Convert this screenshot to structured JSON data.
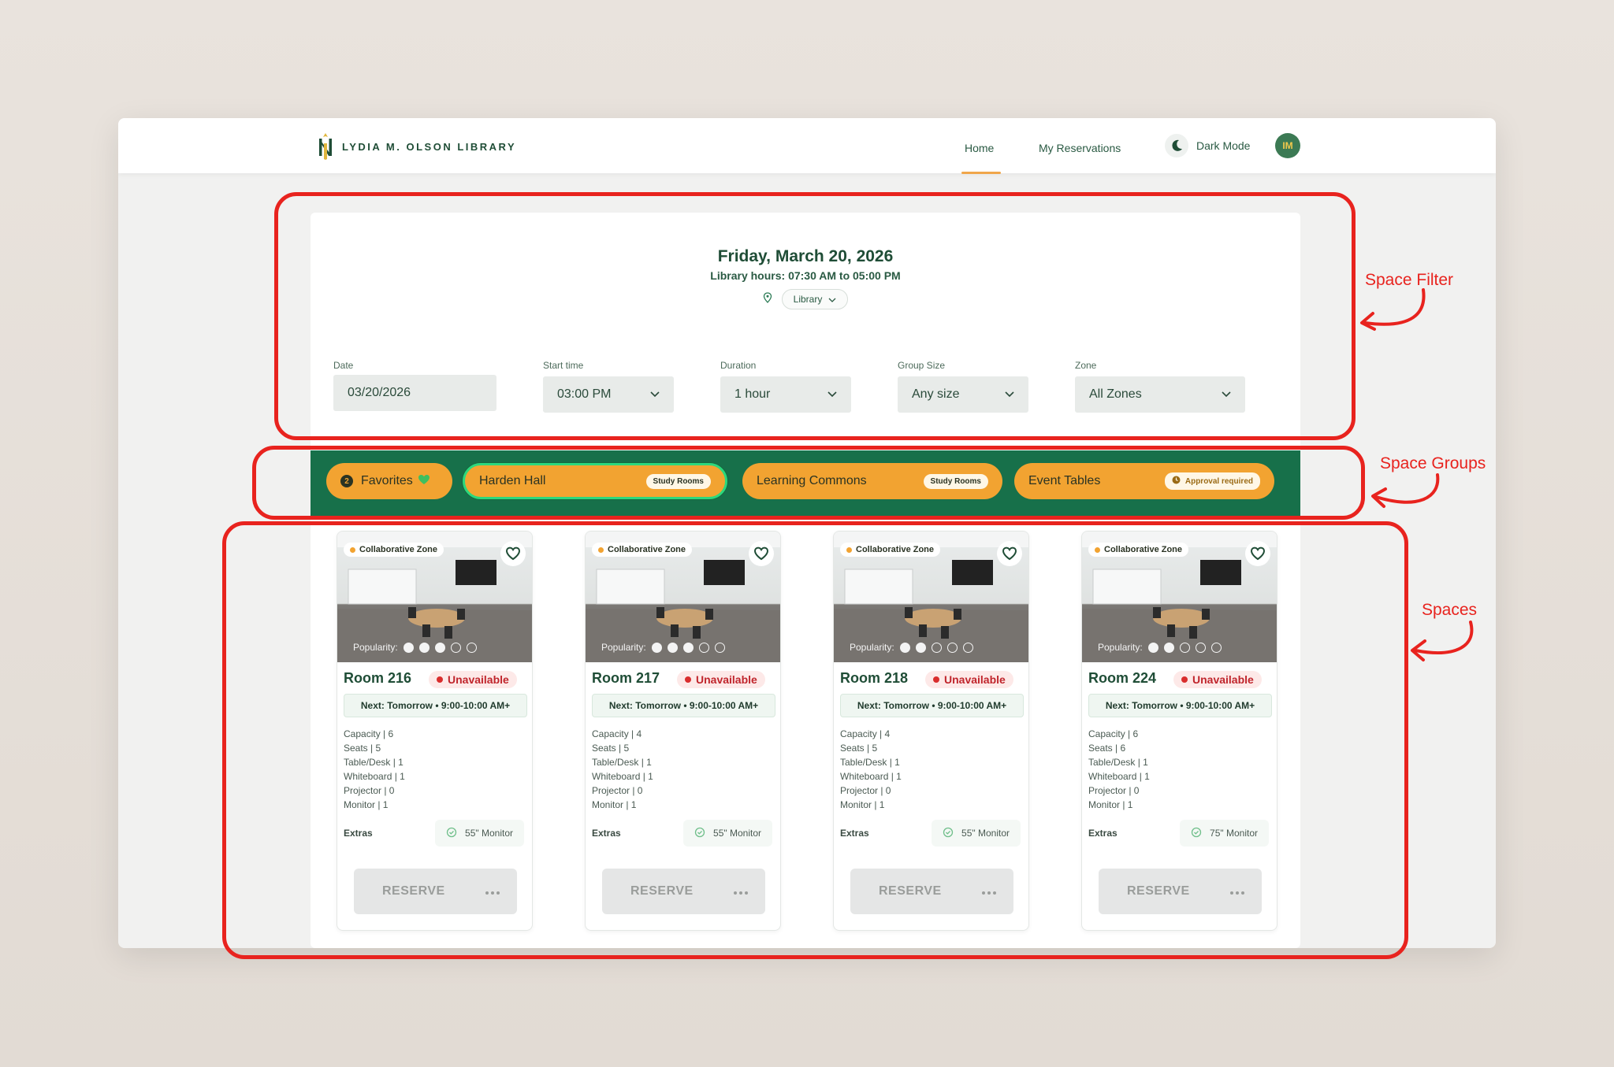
{
  "header": {
    "logo_text": "LYDIA M. OLSON LIBRARY",
    "nav": [
      {
        "label": "Home",
        "active": true
      },
      {
        "label": "My Reservations",
        "active": false
      }
    ],
    "dark_mode_label": "Dark Mode",
    "avatar_initials": "IM"
  },
  "filter": {
    "date_title": "Friday, March 20, 2026",
    "hours": "Library hours: 07:30 AM to 05:00 PM",
    "location": "Library",
    "fields": [
      {
        "label": "Date",
        "value": "03/20/2026"
      },
      {
        "label": "Start time",
        "value": "03:00 PM"
      },
      {
        "label": "Duration",
        "value": "1 hour"
      },
      {
        "label": "Group Size",
        "value": "Any size"
      },
      {
        "label": "Zone",
        "value": "All Zones"
      }
    ]
  },
  "groups": [
    {
      "name": "Favorites",
      "count": "2",
      "badge": ""
    },
    {
      "name": "Harden Hall",
      "badge": "Study Rooms",
      "active": true
    },
    {
      "name": "Learning Commons",
      "badge": "Study Rooms"
    },
    {
      "name": "Event Tables",
      "badge": "Approval required"
    }
  ],
  "spaces": [
    {
      "zone": "Collaborative Zone",
      "popularity_label": "Popularity:",
      "popularity": 3,
      "name": "Room 216",
      "status": "Unavailable",
      "next": "Next: Tomorrow • 9:00-10:00 AM+",
      "specs": [
        "Capacity | 6",
        "Seats | 5",
        "Table/Desk | 1",
        "Whiteboard | 1",
        "Projector | 0",
        "Monitor | 1"
      ],
      "extras_label": "Extras",
      "extra": "55\" Monitor",
      "reserve_label": "RESERVE"
    },
    {
      "zone": "Collaborative Zone",
      "popularity_label": "Popularity:",
      "popularity": 3,
      "name": "Room 217",
      "status": "Unavailable",
      "next": "Next: Tomorrow • 9:00-10:00 AM+",
      "specs": [
        "Capacity | 4",
        "Seats | 5",
        "Table/Desk | 1",
        "Whiteboard | 1",
        "Projector | 0",
        "Monitor | 1"
      ],
      "extras_label": "Extras",
      "extra": "55\" Monitor",
      "reserve_label": "RESERVE"
    },
    {
      "zone": "Collaborative Zone",
      "popularity_label": "Popularity:",
      "popularity": 2,
      "name": "Room 218",
      "status": "Unavailable",
      "next": "Next: Tomorrow • 9:00-10:00 AM+",
      "specs": [
        "Capacity | 4",
        "Seats | 5",
        "Table/Desk | 1",
        "Whiteboard | 1",
        "Projector | 0",
        "Monitor | 1"
      ],
      "extras_label": "Extras",
      "extra": "55\" Monitor",
      "reserve_label": "RESERVE"
    },
    {
      "zone": "Collaborative Zone",
      "popularity_label": "Popularity:",
      "popularity": 2,
      "name": "Room 224",
      "status": "Unavailable",
      "next": "Next: Tomorrow • 9:00-10:00 AM+",
      "specs": [
        "Capacity | 6",
        "Seats | 6",
        "Table/Desk | 1",
        "Whiteboard | 1",
        "Projector | 0",
        "Monitor | 1"
      ],
      "extras_label": "Extras",
      "extra": "75\" Monitor",
      "reserve_label": "RESERVE"
    }
  ],
  "annotations": [
    "Space Filter",
    "Space Groups",
    "Spaces"
  ],
  "colors": {
    "brand_green": "#17704a",
    "accent_orange": "#f2a331",
    "status_red": "#d92d2d",
    "annotation_red": "#e8231e"
  }
}
